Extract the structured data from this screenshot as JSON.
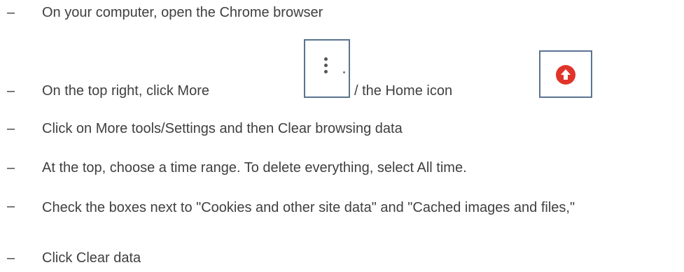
{
  "bullet_glyph": "–",
  "steps": [
    {
      "text": "On your computer, open the Chrome browser"
    },
    {
      "text_before": "On the top right, click More",
      "text_middle": "/ the Home icon",
      "more_icon": "vertical-dots-icon",
      "home_icon": "red-circle-arrow-up-icon"
    },
    {
      "text": "Click on More tools/Settings and then Clear browsing data"
    },
    {
      "text": "At the top, choose a time range. To delete everything, select All time."
    },
    {
      "text": "Check the boxes next to \"Cookies and other site data\" and \"Cached images and files,\""
    },
    {
      "text": "Click Clear data"
    }
  ],
  "colors": {
    "text": "#3f3f3f",
    "icon_border": "#5a7390",
    "home_icon_red": "#e0342a"
  }
}
